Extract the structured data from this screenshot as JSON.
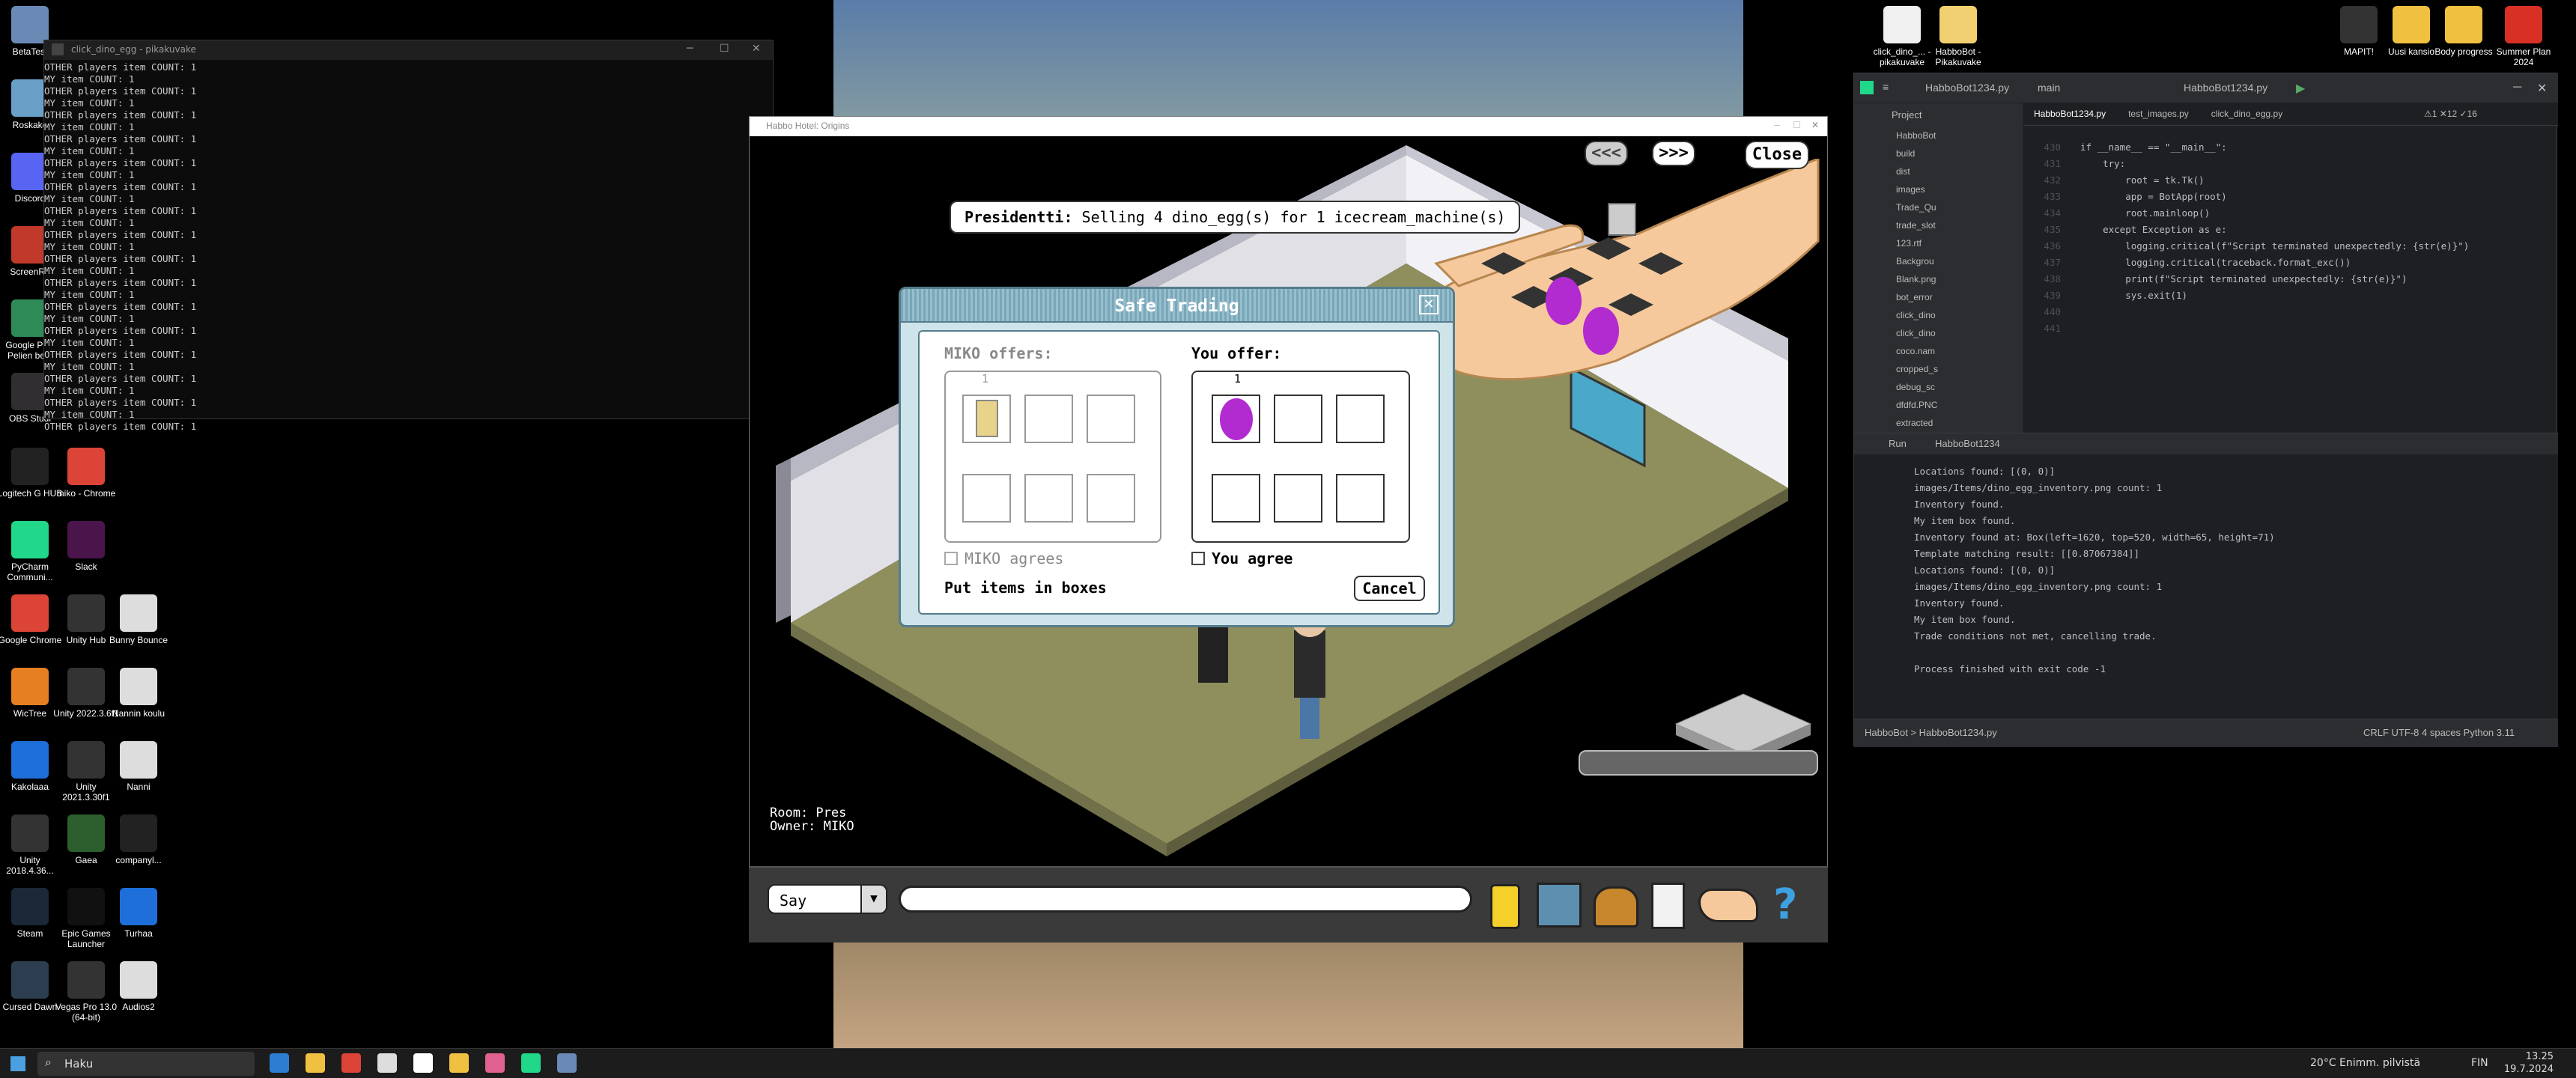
{
  "desktop": {
    "icons": [
      {
        "label": "BetaTest",
        "color": "#6a8ab5"
      },
      {
        "label": "Roskako",
        "color": "#6aa0c8"
      },
      {
        "label": "Discord",
        "color": "#5865F2"
      },
      {
        "label": "ScreenRe",
        "color": "#c0392b"
      },
      {
        "label": "Google Play Pelien beta",
        "color": "#2e8b57"
      },
      {
        "label": "OBS Studi",
        "color": "#302e31"
      },
      {
        "label": "Logitech G HUB",
        "color": "#222"
      },
      {
        "label": "PyCharm Communi...",
        "color": "#21d789"
      },
      {
        "label": "Google Chrome",
        "color": "#db4437"
      },
      {
        "label": "WicTree",
        "color": "#e67e22"
      },
      {
        "label": "Kakolaaa",
        "color": "#1e6fd9"
      },
      {
        "label": "Unity 2018.4.36...",
        "color": "#333"
      },
      {
        "label": "Steam",
        "color": "#1b2838"
      },
      {
        "label": "Cursed Dawn",
        "color": "#2c3e50"
      },
      {
        "label": "miko - Chrome",
        "color": "#db4437"
      },
      {
        "label": "Slack",
        "color": "#4a154b"
      },
      {
        "label": "Unity Hub",
        "color": "#333"
      },
      {
        "label": "Unity 2022.3.6f1",
        "color": "#333"
      },
      {
        "label": "Unity 2021.3.30f1",
        "color": "#333"
      },
      {
        "label": "Gaea",
        "color": "#2c5e2e"
      },
      {
        "label": "Epic Games Launcher",
        "color": "#111"
      },
      {
        "label": "Vegas Pro 13.0 (64-bit)",
        "color": "#333"
      },
      {
        "label": "Bunny Bounce",
        "color": "#ddd"
      },
      {
        "label": "Nannin koulu",
        "color": "#ddd"
      },
      {
        "label": "Nanni",
        "color": "#ddd"
      },
      {
        "label": "companyl...",
        "color": "#222"
      },
      {
        "label": "Turhaa",
        "color": "#1e6fd9"
      },
      {
        "label": "Audios2",
        "color": "#ddd"
      },
      {
        "label": "click_dino_... - pikakuvake",
        "color": "#f0f0f0"
      },
      {
        "label": "HabboBot - Pikakuvake",
        "color": "#f0d070"
      },
      {
        "label": "MAPIT!",
        "color": "#333"
      },
      {
        "label": "Uusi kansio",
        "color": "#f0c040"
      },
      {
        "label": "Body progress",
        "color": "#f0c040"
      },
      {
        "label": "Summer Plan 2024",
        "color": "#d93025"
      }
    ]
  },
  "console": {
    "title": "click_dino_egg - pikakuvake",
    "lines": [
      "OTHER players item COUNT: 1",
      "MY item COUNT: 1",
      "OTHER players item COUNT: 1",
      "MY item COUNT: 1",
      "OTHER players item COUNT: 1",
      "MY item COUNT: 1",
      "OTHER players item COUNT: 1",
      "MY item COUNT: 1",
      "OTHER players item COUNT: 1",
      "MY item COUNT: 1",
      "OTHER players item COUNT: 1",
      "MY item COUNT: 1",
      "OTHER players item COUNT: 1",
      "MY item COUNT: 1",
      "OTHER players item COUNT: 1",
      "MY item COUNT: 1",
      "OTHER players item COUNT: 1",
      "MY item COUNT: 1",
      "OTHER players item COUNT: 1",
      "MY item COUNT: 1",
      "OTHER players item COUNT: 1",
      "MY item COUNT: 1",
      "OTHER players item COUNT: 1",
      "MY item COUNT: 1",
      "OTHER players item COUNT: 1",
      "MY item COUNT: 1",
      "OTHER players item COUNT: 1",
      "MY item COUNT: 1",
      "OTHER players item COUNT: 1",
      "MY item COUNT: 1",
      "OTHER players item COUNT: 1"
    ]
  },
  "game": {
    "window_title": "Habbo Hotel: Origins",
    "speech_name": "Presidentti:",
    "speech_text": " Selling 4 dino_egg(s) for 1 icecream_machine(s)",
    "prev_label": "<<<",
    "next_label": ">>>",
    "close_label": "Close",
    "room_label": "Room: Pres",
    "owner_label": "Owner: MIKO",
    "say_label": "Say",
    "chat_placeholder": ""
  },
  "trade": {
    "title": "Safe Trading",
    "other_offers": "MIKO offers:",
    "other_count": "1",
    "you_offer": "You offer:",
    "your_count": "1",
    "other_agrees": "MIKO agrees",
    "you_agree": "You agree",
    "hint": "Put items in boxes",
    "cancel_label": "Cancel"
  },
  "ide": {
    "project_name": "HabboBot1234.py",
    "branch": "main",
    "run_config": "HabboBot1234.py",
    "project_label": "Project",
    "tabs": [
      "HabboBot1234.py",
      "test_images.py",
      "click_dino_egg.py"
    ],
    "inspections": "⚠1  ✕12  ✓16",
    "tree": [
      "HabboBot",
      "build",
      "dist",
      "images",
      "Trade_Qu",
      "trade_slot",
      "123.rtf",
      "Backgrou",
      "Blank.png",
      "bot_error",
      "click_dino",
      "click_dino",
      "coco.nam",
      "cropped_s",
      "debug_sc",
      "dfdfd.PNC",
      "extracted"
    ],
    "line_numbers": [
      "430",
      "431",
      "432",
      "433",
      "434",
      "435",
      "436",
      "437",
      "438",
      "439",
      "440",
      "441"
    ],
    "code": [
      "if __name__ == \"__main__\":",
      "    try:",
      "        root = tk.Tk()",
      "        app = BotApp(root)",
      "        root.mainloop()",
      "    except Exception as e:",
      "        logging.critical(f\"Script terminated unexpectedly: {str(e)}\")",
      "        logging.critical(traceback.format_exc())",
      "        print(f\"Script terminated unexpectedly: {str(e)}\")",
      "        sys.exit(1)",
      ""
    ],
    "run_tab": "Run",
    "run_file": "HabboBot1234",
    "output": [
      "Locations found: [(0, 0)]",
      "images/Items/dino_egg_inventory.png count: 1",
      "Inventory found.",
      "My item box found.",
      "Inventory found at: Box(left=1620, top=520, width=65, height=71)",
      "Template matching result: [[0.87067384]]",
      "Locations found: [(0, 0)]",
      "images/Items/dino_egg_inventory.png count: 1",
      "Inventory found.",
      "My item box found.",
      "Trade conditions not met, cancelling trade.",
      "",
      "Process finished with exit code -1"
    ],
    "status_left": "HabboBot  >  HabboBot1234.py",
    "status_right": "CRLF   UTF-8   4 spaces   Python 3.11"
  },
  "taskbar": {
    "search": "Haku",
    "weather": "20°C  Enimm. pilvistä",
    "lang": "FIN",
    "time": "13.25",
    "date": "19.7.2024"
  }
}
